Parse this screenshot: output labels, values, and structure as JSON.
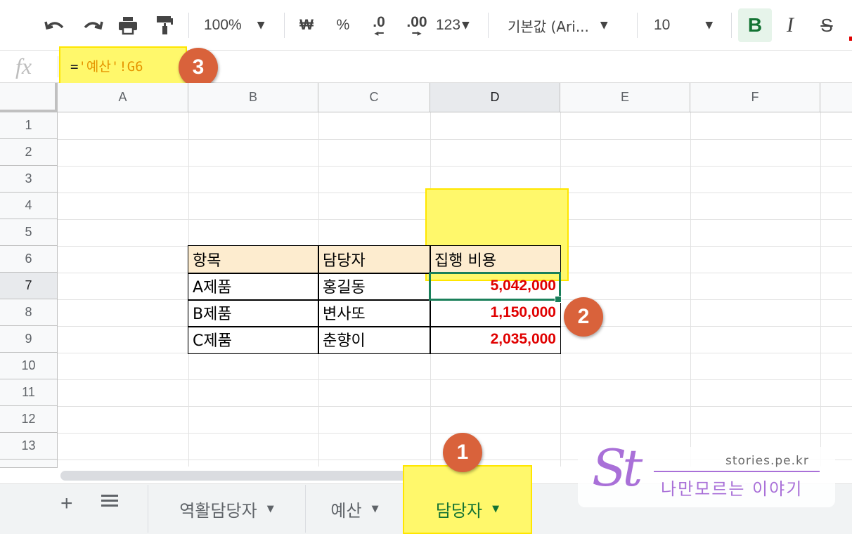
{
  "toolbar": {
    "undo_icon": "↶",
    "redo_icon": "↷",
    "print_icon": "print-icon",
    "paint_format_icon": "paint-format-icon",
    "zoom": "100%",
    "currency": "₩",
    "percent": "%",
    "decrease_decimal": ".0",
    "increase_decimal": ".00",
    "number_format": "123",
    "font_family": "기본값 (Ari...",
    "font_size": "10",
    "bold": "B",
    "italic": "I",
    "strikethrough": "S"
  },
  "formula_bar": {
    "fx_label": "fx",
    "formula_eq": "=",
    "formula_ref": "'예산'!G6"
  },
  "grid": {
    "columns": [
      "A",
      "B",
      "C",
      "D",
      "E",
      "F"
    ],
    "selected_column": "D",
    "rows": [
      "1",
      "2",
      "3",
      "4",
      "5",
      "6",
      "7",
      "8",
      "9",
      "10",
      "11",
      "12",
      "13"
    ],
    "selected_row": "7"
  },
  "table": {
    "headers": [
      "항목",
      "담당자",
      "집행 비용"
    ],
    "rows": [
      [
        "A제품",
        "홍길동",
        "5,042,000"
      ],
      [
        "B제품",
        "변사또",
        "1,150,000"
      ],
      [
        "C제품",
        "춘향이",
        "2,035,000"
      ]
    ]
  },
  "annotations": {
    "badge_1": "1",
    "badge_2": "2",
    "badge_3": "3",
    "highlight_color": "#fff86b"
  },
  "sheet_tabs": {
    "add": "+",
    "tabs": [
      {
        "label": "역활담당자",
        "active": false
      },
      {
        "label": "예산",
        "active": false
      },
      {
        "label": "담당자",
        "active": true
      }
    ]
  },
  "watermark": {
    "logo": "St",
    "url": "stories.pe.kr",
    "tagline": "나만모르는 이야기"
  },
  "colors": {
    "accent_green": "#137333",
    "value_red": "#e00000",
    "badge_orange": "#d9623b",
    "watermark_purple": "#a970d8"
  }
}
